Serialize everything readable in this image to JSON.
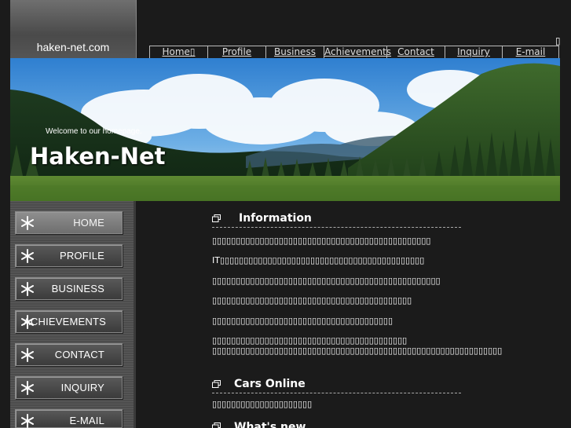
{
  "header": {
    "logo_text": "haken-net.com",
    "corner_glyph": "▯",
    "nav": [
      {
        "label": "Home▯"
      },
      {
        "label": "Profile"
      },
      {
        "label": "Business"
      },
      {
        "label": "Achievements"
      },
      {
        "label": "Contact"
      },
      {
        "label": "Inquiry"
      },
      {
        "label": "E-mail"
      }
    ]
  },
  "banner": {
    "welcome": "Welcome to our homepage.",
    "title": "Haken-Net"
  },
  "sidebar": {
    "icon": "snowflake-icon",
    "items": [
      {
        "label": "HOME"
      },
      {
        "label": "PROFILE"
      },
      {
        "label": "BUSINESS"
      },
      {
        "label": "ACHIEVEMENTS"
      },
      {
        "label": "CONTACT"
      },
      {
        "label": "INQUIRY"
      },
      {
        "label": "E-MAIL"
      }
    ]
  },
  "main": {
    "section_icon": "window-stack-icon",
    "sections": [
      {
        "title": "Information",
        "paragraphs": [
          "▯▯▯▯▯▯▯▯▯▯▯▯▯▯▯▯▯▯▯▯▯▯▯▯▯▯▯▯▯▯▯▯▯▯▯▯▯▯▯▯▯▯▯▯▯▯",
          "IT▯▯▯▯▯▯▯▯▯▯▯▯▯▯▯▯▯▯▯▯▯▯▯▯▯▯▯▯▯▯▯▯▯▯▯▯▯▯▯▯▯▯▯",
          "▯▯▯▯▯▯▯▯▯▯▯▯▯▯▯▯▯▯▯▯▯▯▯▯▯▯▯▯▯▯▯▯▯▯▯▯▯▯▯▯▯▯▯▯▯▯▯▯",
          "▯▯▯▯▯▯▯▯▯▯▯▯▯▯▯▯▯▯▯▯▯▯▯▯▯▯▯▯▯▯▯▯▯▯▯▯▯▯▯▯▯▯",
          "▯▯▯▯▯▯▯▯▯▯▯▯▯▯▯▯▯▯▯▯▯▯▯▯▯▯▯▯▯▯▯▯▯▯▯▯▯▯",
          "▯▯▯▯▯▯▯▯▯▯▯▯▯▯▯▯▯▯▯▯▯▯▯▯▯▯▯▯▯▯▯▯▯▯▯▯▯▯▯▯▯",
          "▯▯▯▯▯▯▯▯▯▯▯▯▯▯▯▯▯▯▯▯▯▯▯▯▯▯▯▯▯▯▯▯▯▯▯▯▯▯▯▯▯▯▯▯▯▯▯▯▯▯▯▯▯▯▯▯▯▯▯▯▯"
        ]
      },
      {
        "title": "Cars Online",
        "paragraphs": [
          "▯▯▯▯▯▯▯▯▯▯▯▯▯▯▯▯▯▯▯▯▯"
        ]
      },
      {
        "title": "What's new",
        "paragraphs": []
      }
    ]
  },
  "colors": {
    "background": "#1b1b1b",
    "sidebar": "#4f4f4f",
    "active_button": "#7f7f7f"
  }
}
